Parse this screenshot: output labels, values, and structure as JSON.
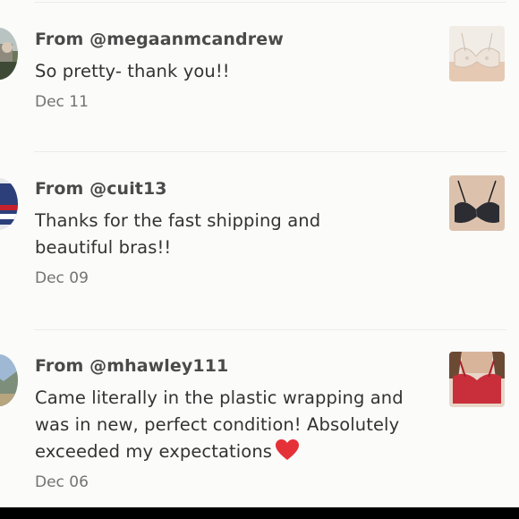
{
  "reviews": [
    {
      "from": "From @megaanmcandrew",
      "comment": "So pretty- thank you!!",
      "date": "Dec 11",
      "colors": {
        "product": "#e9ddd0"
      }
    },
    {
      "from": "From @cuit13",
      "comment": "Thanks for the fast shipping and beautiful bras!!",
      "date": "Dec 09",
      "colors": {
        "product": "#2b2d33"
      }
    },
    {
      "from": "From @mhawley111",
      "comment": "Came literally in the plastic wrapping and was in new, perfect condition! Absolutely exceeded my expectations",
      "date": "Dec 06",
      "emoji": "red-heart-icon",
      "colors": {
        "product": "#c92f3a"
      }
    }
  ],
  "colors": {
    "background": "#fbfbfa",
    "divider": "#ecebe8",
    "username_text": "#4a4a4a",
    "comment_text": "#333333",
    "date_text": "#737373",
    "heart": "#e53138"
  }
}
